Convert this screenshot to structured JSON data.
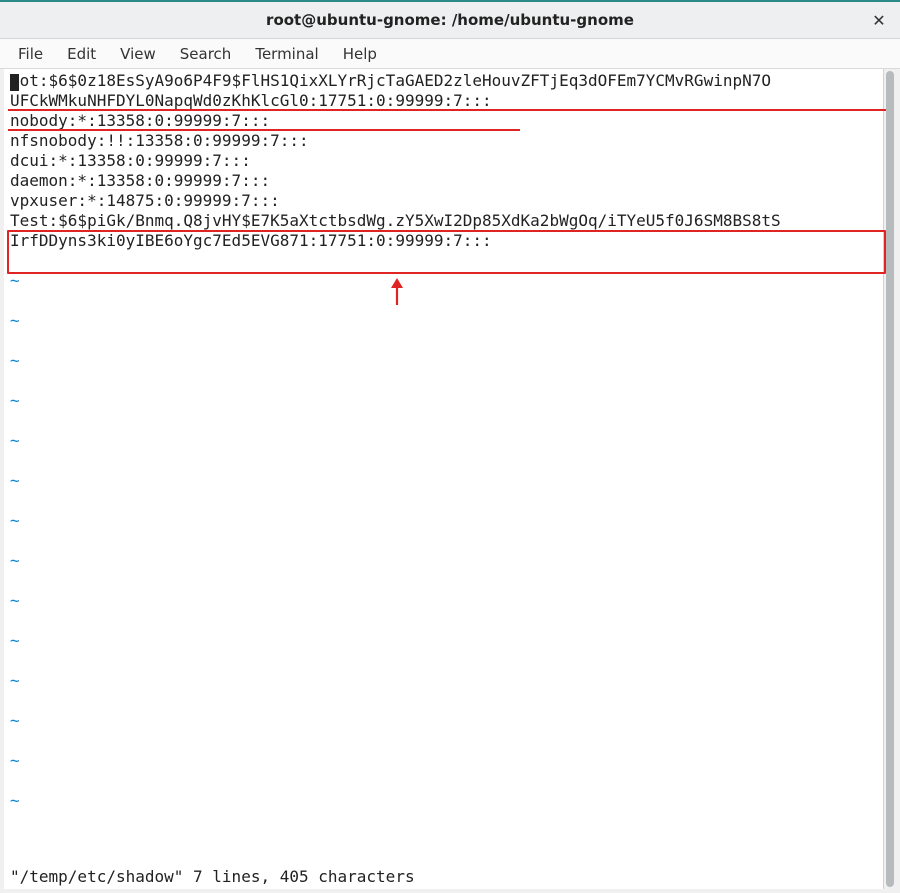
{
  "title": "root@ubuntu-gnome: /home/ubuntu-gnome",
  "menu": {
    "file": "File",
    "edit": "Edit",
    "view": "View",
    "search": "Search",
    "terminal": "Terminal",
    "help": "Help"
  },
  "shadow_lines": {
    "root_a": "oot:$6$0z18EsSyA9o6P4F9$FlHS1QixXLYrRjcTaGAED2zleHouvZFTjEq3dOFEm7YCMvRGwinpN7O",
    "root_b": "UFCkWMkuNHFDYL0NapqWd0zKhKlcGl0:17751:0:99999:7:::",
    "nobody": "nobody:*:13358:0:99999:7:::",
    "nfsnobody": "nfsnobody:!!:13358:0:99999:7:::",
    "dcui": "dcui:*:13358:0:99999:7:::",
    "daemon": "daemon:*:13358:0:99999:7:::",
    "vpxuser": "vpxuser:*:14875:0:99999:7:::",
    "test_a": "Test:$6$piGk/Bnmq.Q8jvHY$E7K5aXtctbsdWg.zY5XwI2Dp85XdKa2bWgOq/iTYeU5f0J6SM8BS8tS",
    "test_b": "IrfDDyns3ki0yIBE6oYgc7Ed5EVG871:17751:0:99999:7:::"
  },
  "status_line": "\"/temp/etc/shadow\" 7 lines, 405 characters",
  "tilde": "~",
  "colors": {
    "annotation": "#e02424",
    "tilde": "#0b84d6",
    "titlebar_accent": "#2a8a8a"
  }
}
